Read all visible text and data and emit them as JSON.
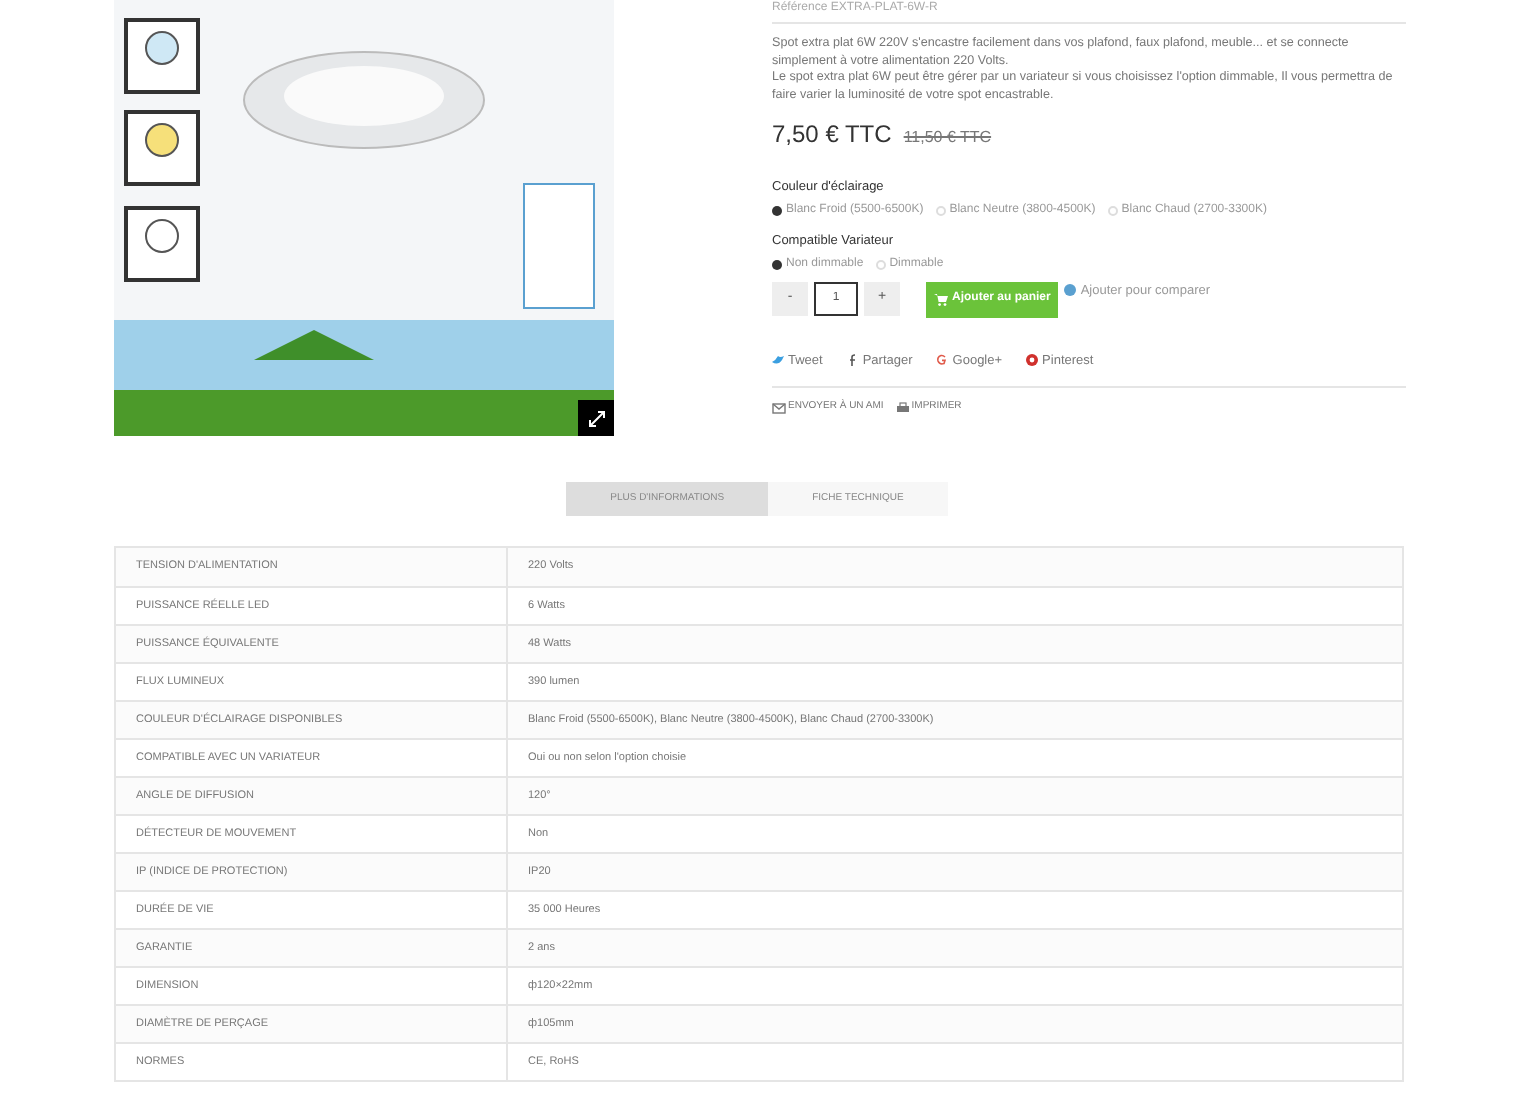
{
  "reference": "Référence EXTRA-PLAT-6W-R",
  "description": [
    "Spot extra plat 6W 220V s'encastre facilement dans vos plafond, faux plafond, meuble... et se connecte simplement à votre alimentation 220 Volts.",
    "Le spot extra plat 6W peut être gérer par un variateur si vous choisissez l'option dimmable, Il vous permettra de faire varier la luminosité de votre spot encastrable."
  ],
  "price": "7,50 € TTC",
  "old_price": "11,50 € TTC",
  "options": [
    {
      "label": "Couleur d'éclairage",
      "choices": [
        {
          "label": "Blanc Froid (5500-6500K)",
          "selected": true
        },
        {
          "label": "Blanc Neutre (3800-4500K)",
          "selected": false
        },
        {
          "label": "Blanc Chaud (2700-3300K)",
          "selected": false
        }
      ]
    },
    {
      "label": "Compatible Variateur",
      "choices": [
        {
          "label": "Non dimmable",
          "selected": true
        },
        {
          "label": "Dimmable",
          "selected": false
        }
      ]
    }
  ],
  "quantity": {
    "minus": "-",
    "value": "1",
    "plus": "+"
  },
  "add_to_cart": "Ajouter au panier",
  "compare": "Ajouter pour comparer",
  "share": [
    {
      "kind": "twitter",
      "label": "Tweet"
    },
    {
      "kind": "facebook",
      "label": "Partager"
    },
    {
      "kind": "google",
      "label": "Google+"
    },
    {
      "kind": "pinterest",
      "label": "Pinterest"
    }
  ],
  "actions": [
    {
      "kind": "mail",
      "label": "ENVOYER À UN AMI"
    },
    {
      "kind": "print",
      "label": "IMPRIMER"
    }
  ],
  "tabs": [
    {
      "label": "PLUS D'INFORMATIONS",
      "selected": true
    },
    {
      "label": "FICHE TECHNIQUE",
      "selected": false
    }
  ],
  "specs": [
    [
      "TENSION D'ALIMENTATION",
      "220 Volts"
    ],
    [
      "PUISSANCE RÉELLE LED",
      "6 Watts"
    ],
    [
      "PUISSANCE ÉQUIVALENTE",
      "48 Watts"
    ],
    [
      "FLUX LUMINEUX",
      "390 lumen"
    ],
    [
      "COULEUR D'ÉCLAIRAGE DISPONIBLES",
      "Blanc Froid (5500-6500K), Blanc Neutre (3800-4500K), Blanc Chaud (2700-3300K)"
    ],
    [
      "COMPATIBLE AVEC UN VARIATEUR",
      "Oui ou non selon l'option choisie"
    ],
    [
      "ANGLE DE DIFFUSION",
      "120°"
    ],
    [
      "DÉTECTEUR DE MOUVEMENT",
      "Non"
    ],
    [
      "IP (INDICE DE PROTECTION)",
      "IP20"
    ],
    [
      "DURÉE DE VIE",
      "35 000 Heures"
    ],
    [
      "GARANTIE",
      "2 ans"
    ],
    [
      "DIMENSION",
      "ф120×22mm"
    ],
    [
      "DIAMÈTRE DE PERÇAGE",
      "ф105mm"
    ],
    [
      "NORMES",
      "CE, RoHS"
    ]
  ]
}
